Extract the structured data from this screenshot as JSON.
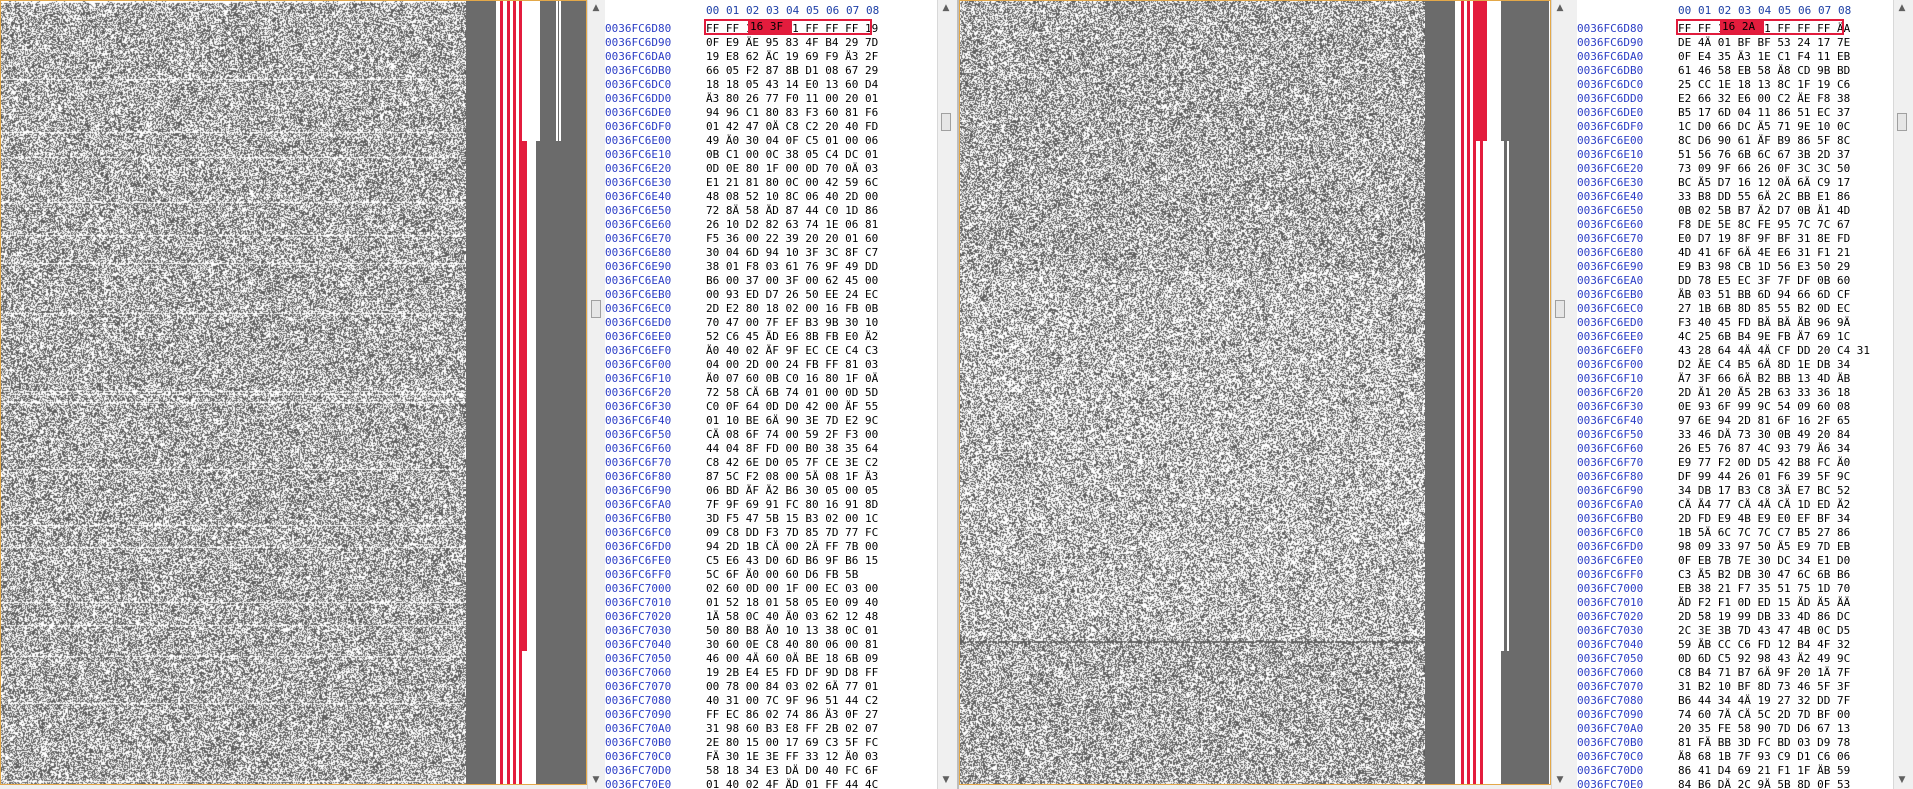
{
  "colors": {
    "pixel_dark": "#5f5f5f",
    "pixel_light": "#ffffff",
    "selection_red": "#e31c3d",
    "address_blue": "#2c3ec6",
    "frame_orange": "#e3a849",
    "scrollbar": "#f0f0f0"
  },
  "column_header": [
    "00",
    "01",
    "02",
    "03",
    "04",
    "05",
    "06",
    "07",
    "08"
  ],
  "left_pane": {
    "selected_bytes_text": "16 3F",
    "rows": [
      {
        "address": "0036FC6D80",
        "bytes": "FF FF 16 3F 01 FF FF FF 19"
      },
      {
        "address": "0036FC6D90",
        "bytes": "0F E9 ÄE 95 83 4F B4 29 7D"
      },
      {
        "address": "0036FC6DA0",
        "bytes": "19 E8 62 ÄC 19 69 F9 Ä3 2F"
      },
      {
        "address": "0036FC6DB0",
        "bytes": "66 05 F2 87 8B D1 08 67 29"
      },
      {
        "address": "0036FC6DC0",
        "bytes": "18 18 05 43 14 E0 13 60 D4"
      },
      {
        "address": "0036FC6DD0",
        "bytes": "Ä3 80 26 77 F0 11 00 20 01"
      },
      {
        "address": "0036FC6DE0",
        "bytes": "94 96 C1 80 83 F3 60 81 F6"
      },
      {
        "address": "0036FC6DF0",
        "bytes": "01 42 47 0Ä C8 C2 20 40 FD"
      },
      {
        "address": "0036FC6E00",
        "bytes": "49 Ä0 30 04 0F C5 01 00 06"
      },
      {
        "address": "0036FC6E10",
        "bytes": "0B C1 00 0C 38 05 C4 DC 01"
      },
      {
        "address": "0036FC6E20",
        "bytes": "0D 0E 80 1F 00 0D 70 0Ä 03"
      },
      {
        "address": "0036FC6E30",
        "bytes": "E1 21 81 80 0C 00 42 59 6C"
      },
      {
        "address": "0036FC6E40",
        "bytes": "48 08 52 10 8C 06 40 2D 00"
      },
      {
        "address": "0036FC6E50",
        "bytes": "72 8Ä 58 ÄD 87 44 C0 1D 86"
      },
      {
        "address": "0036FC6E60",
        "bytes": "26 10 D2 82 63 74 1E 06 81"
      },
      {
        "address": "0036FC6E70",
        "bytes": "F5 36 00 22 39 20 20 01 60"
      },
      {
        "address": "0036FC6E80",
        "bytes": "30 04 6D 94 10 3F 3C 8F C7"
      },
      {
        "address": "0036FC6E90",
        "bytes": "38 01 F8 03 61 76 9F 49 DD"
      },
      {
        "address": "0036FC6EA0",
        "bytes": "B6 00 37 00 3F 00 62 45 00"
      },
      {
        "address": "0036FC6EB0",
        "bytes": "00 93 ED D7 26 50 EE 24 EC"
      },
      {
        "address": "0036FC6EC0",
        "bytes": "2D E2 80 18 02 00 16 FB 0B"
      },
      {
        "address": "0036FC6ED0",
        "bytes": "70 47 00 7F EF B3 9B 30 10"
      },
      {
        "address": "0036FC6EE0",
        "bytes": "52 C6 45 ÄD E6 8B FB E0 Ä2"
      },
      {
        "address": "0036FC6EF0",
        "bytes": "Ä0 40 02 ÄF 9F EC CE C4 C3"
      },
      {
        "address": "0036FC6F00",
        "bytes": "04 00 2D 00 24 FB FF 81 03"
      },
      {
        "address": "0036FC6F10",
        "bytes": "Ä0 07 60 0B C0 16 80 1F 0Ä"
      },
      {
        "address": "0036FC6F20",
        "bytes": "72 58 CÄ 6B 74 01 00 0D 5D"
      },
      {
        "address": "0036FC6F30",
        "bytes": "C0 0F 64 0D D0 42 00 ÄF 55"
      },
      {
        "address": "0036FC6F40",
        "bytes": "01 10 BE 6Ä 90 3E 7D E2 9C"
      },
      {
        "address": "0036FC6F50",
        "bytes": "CÄ 08 6F 74 00 59 2F F3 00"
      },
      {
        "address": "0036FC6F60",
        "bytes": "44 04 8F FD 00 B0 38 35 64"
      },
      {
        "address": "0036FC6F70",
        "bytes": "C8 42 6E D0 05 7F CE 3E C2"
      },
      {
        "address": "0036FC6F80",
        "bytes": "87 5C F2 08 00 5Ä 08 1F Ä3"
      },
      {
        "address": "0036FC6F90",
        "bytes": "06 BD ÄF Ä2 B6 30 05 00 05"
      },
      {
        "address": "0036FC6FA0",
        "bytes": "7F 9F 69 91 FC 80 16 91 8D"
      },
      {
        "address": "0036FC6FB0",
        "bytes": "3D F5 47 5B 15 B3 02 00 1C"
      },
      {
        "address": "0036FC6FC0",
        "bytes": "09 C8 DD F3 7D 85 7D 77 FC"
      },
      {
        "address": "0036FC6FD0",
        "bytes": "94 2D 1B CÄ 00 2Ä FF 7B 00"
      },
      {
        "address": "0036FC6FE0",
        "bytes": "C5 E6 43 D0 6D B6 9F B6 15"
      },
      {
        "address": "0036FC6FF0",
        "bytes": "5C 6F Ä0 00 60 D6 FB 5B"
      },
      {
        "address": "0036FC7000",
        "bytes": "02 60 0D 00 1F 00 EC 03 00"
      },
      {
        "address": "0036FC7010",
        "bytes": "01 52 18 01 58 05 E0 09 40"
      },
      {
        "address": "0036FC7020",
        "bytes": "1Ä 58 0C 40 Ä0 03 62 12 48"
      },
      {
        "address": "0036FC7030",
        "bytes": "50 80 B8 Ä0 10 13 38 0C 01"
      },
      {
        "address": "0036FC7040",
        "bytes": "30 60 0E C8 40 80 06 00 81"
      },
      {
        "address": "0036FC7050",
        "bytes": "46 00 4Ä 60 0Ä BE 18 6B 09"
      },
      {
        "address": "0036FC7060",
        "bytes": "19 2B E4 E5 FD DF 9D D8 FF"
      },
      {
        "address": "0036FC7070",
        "bytes": "00 78 00 84 03 02 6Ä 77 01"
      },
      {
        "address": "0036FC7080",
        "bytes": "40 31 00 7C 9F 96 51 44 C2"
      },
      {
        "address": "0036FC7090",
        "bytes": "FF EC 86 02 74 86 Ä3 0F 27"
      },
      {
        "address": "0036FC70A0",
        "bytes": "31 98 60 B3 E8 FF 2B 02 07"
      },
      {
        "address": "0036FC70B0",
        "bytes": "2E 80 15 00 17 69 C3 5F FC"
      },
      {
        "address": "0036FC70C0",
        "bytes": "FÄ 30 1E 3E FF 33 12 Ä0 03"
      },
      {
        "address": "0036FC70D0",
        "bytes": "58 18 34 E3 DÄ D0 40 FC 6F"
      },
      {
        "address": "0036FC70E0",
        "bytes": "01 40 02 4F ÄD 01 FF 44 4C"
      }
    ]
  },
  "right_pane": {
    "selected_bytes_text": "16 2A",
    "rows": [
      {
        "address": "0036FC6D80",
        "bytes": "FF FF 16 2A 01 FF FF FF ÄA"
      },
      {
        "address": "0036FC6D90",
        "bytes": "DE 4Ä 01 BF BF 53 24 17 7E"
      },
      {
        "address": "0036FC6DA0",
        "bytes": "0F E4 35 Ä3 1E C1 F4 11 EB"
      },
      {
        "address": "0036FC6DB0",
        "bytes": "61 46 58 EB 58 Ä8 CD 9B BD"
      },
      {
        "address": "0036FC6DC0",
        "bytes": "25 CC 1E 18 13 8C 1F 19 C6"
      },
      {
        "address": "0036FC6DD0",
        "bytes": "E2 66 32 E6 00 C2 ÄE F8 38"
      },
      {
        "address": "0036FC6DE0",
        "bytes": "B5 17 6D 04 11 86 51 EC 37"
      },
      {
        "address": "0036FC6DF0",
        "bytes": "1C D0 66 DC Ä5 71 9E 10 0C"
      },
      {
        "address": "0036FC6E00",
        "bytes": "8C D6 90 61 ÄF B9 86 5F 8C"
      },
      {
        "address": "0036FC6E10",
        "bytes": "51 56 76 6B 6C 67 3B 2D 37"
      },
      {
        "address": "0036FC6E20",
        "bytes": "73 09 9F 66 26 0F 3C 3C 50"
      },
      {
        "address": "0036FC6E30",
        "bytes": "BC Ä5 D7 16 12 0Ä 6Ä C9 17"
      },
      {
        "address": "0036FC6E40",
        "bytes": "33 B8 DD 55 6Ä 2C BB E1 86"
      },
      {
        "address": "0036FC6E50",
        "bytes": "0B 02 5B B7 Ä2 D7 0B Ä1 4D"
      },
      {
        "address": "0036FC6E60",
        "bytes": "F8 DE 5E 8C FE 95 7C 7C 67"
      },
      {
        "address": "0036FC6E70",
        "bytes": "E0 D7 19 8F 9F BF 31 8E FD"
      },
      {
        "address": "0036FC6E80",
        "bytes": "4D 41 6F 6Ä 4E E6 31 F1 21"
      },
      {
        "address": "0036FC6E90",
        "bytes": "E9 B3 98 CB 1D 56 E3 50 29"
      },
      {
        "address": "0036FC6EA0",
        "bytes": "DD 78 E5 EC 3F 7F DF 0B 60"
      },
      {
        "address": "0036FC6EB0",
        "bytes": "ÄB 03 51 BB 6D 94 66 6D CF"
      },
      {
        "address": "0036FC6EC0",
        "bytes": "27 1B 6B 8D 85 55 B2 0D EC"
      },
      {
        "address": "0036FC6ED0",
        "bytes": "F3 40 45 FD BÄ BÄ ÄB 96 9Ä"
      },
      {
        "address": "0036FC6EE0",
        "bytes": "4C 25 6B B4 9E FB Ä7 69 1C"
      },
      {
        "address": "0036FC6EF0",
        "bytes": "43 28 64 4Ä 4Ä CF DD 20 C4 31"
      },
      {
        "address": "0036FC6F00",
        "bytes": "D2 ÄE C4 B5 6Ä 8D 1E DB 34"
      },
      {
        "address": "0036FC6F10",
        "bytes": "Ä7 3F 66 6Ä B2 BB 13 4D ÄB"
      },
      {
        "address": "0036FC6F20",
        "bytes": "2D Ä1 20 Ä5 2B 63 33 36 18"
      },
      {
        "address": "0036FC6F30",
        "bytes": "0E 93 6F 99 9C 54 09 60 08"
      },
      {
        "address": "0036FC6F40",
        "bytes": "97 6E 94 2D 81 6F 16 2F 65"
      },
      {
        "address": "0036FC6F50",
        "bytes": "33 46 DÄ 73 30 0B 49 20 84"
      },
      {
        "address": "0036FC6F60",
        "bytes": "26 E5 76 87 4C 93 79 Ä6 34"
      },
      {
        "address": "0036FC6F70",
        "bytes": "E9 77 F2 0D D5 42 B8 FC Ä0"
      },
      {
        "address": "0036FC6F80",
        "bytes": "DF 99 44 26 01 F6 39 5F 9C"
      },
      {
        "address": "0036FC6F90",
        "bytes": "34 DB 17 B3 C8 3Ä E7 BC 52"
      },
      {
        "address": "0036FC6FA0",
        "bytes": "CÄ Ä4 77 CÄ 4Ä CÄ 1D ED Ä2"
      },
      {
        "address": "0036FC6FB0",
        "bytes": "2D FD E9 4B E9 E0 EF BF 34"
      },
      {
        "address": "0036FC6FC0",
        "bytes": "1B 5Ä 6C 7C 7C C7 B5 27 86"
      },
      {
        "address": "0036FC6FD0",
        "bytes": "98 09 33 97 50 Ä5 E9 7D EB"
      },
      {
        "address": "0036FC6FE0",
        "bytes": "0F EB 7B 7E 30 DC 34 E1 D0"
      },
      {
        "address": "0036FC6FF0",
        "bytes": "C3 Ä5 B2 DB 30 47 6C 6B B6"
      },
      {
        "address": "0036FC7000",
        "bytes": "EB 38 21 F7 35 51 75 1D 70"
      },
      {
        "address": "0036FC7010",
        "bytes": "ÄD F2 F1 0D ED 15 ÄD Ä5 ÄÄ"
      },
      {
        "address": "0036FC7020",
        "bytes": "2D 58 19 99 DB 33 4D 86 DC"
      },
      {
        "address": "0036FC7030",
        "bytes": "2C 3E 3B 7D 43 47 4B 0C D5"
      },
      {
        "address": "0036FC7040",
        "bytes": "59 ÄB CC C6 FD 12 B4 4F 32"
      },
      {
        "address": "0036FC7050",
        "bytes": "0D 6D C5 92 98 43 Ä2 49 9C"
      },
      {
        "address": "0036FC7060",
        "bytes": "C8 B4 71 B7 6Ä 9F 20 1Ä 7F"
      },
      {
        "address": "0036FC7070",
        "bytes": "31 B2 10 BF 8D 73 46 5F 3F"
      },
      {
        "address": "0036FC7080",
        "bytes": "B6 44 34 4Ä 19 27 32 DD 7F"
      },
      {
        "address": "0036FC7090",
        "bytes": "74 60 7Ä CÄ 5C 2D 7D BF 00"
      },
      {
        "address": "0036FC70A0",
        "bytes": "20 35 FE 58 90 7D D6 67 13"
      },
      {
        "address": "0036FC70B0",
        "bytes": "81 FÄ BB 3D FC BD 03 D9 78"
      },
      {
        "address": "0036FC70C0",
        "bytes": "Ä8 68 1B 7F 93 C9 D1 C6 06"
      },
      {
        "address": "0036FC70D0",
        "bytes": "86 41 D4 69 21 F1 1F ÄB 59"
      },
      {
        "address": "0036FC70E0",
        "bytes": "84 B6 DÄ 2C 9Ä 5B 8D 0F 53"
      }
    ]
  },
  "icons": {
    "scroll_up": "scroll-up-arrow-icon",
    "scroll_down": "scroll-down-arrow-icon",
    "scroll_thumb": "scroll-thumb-icon"
  }
}
